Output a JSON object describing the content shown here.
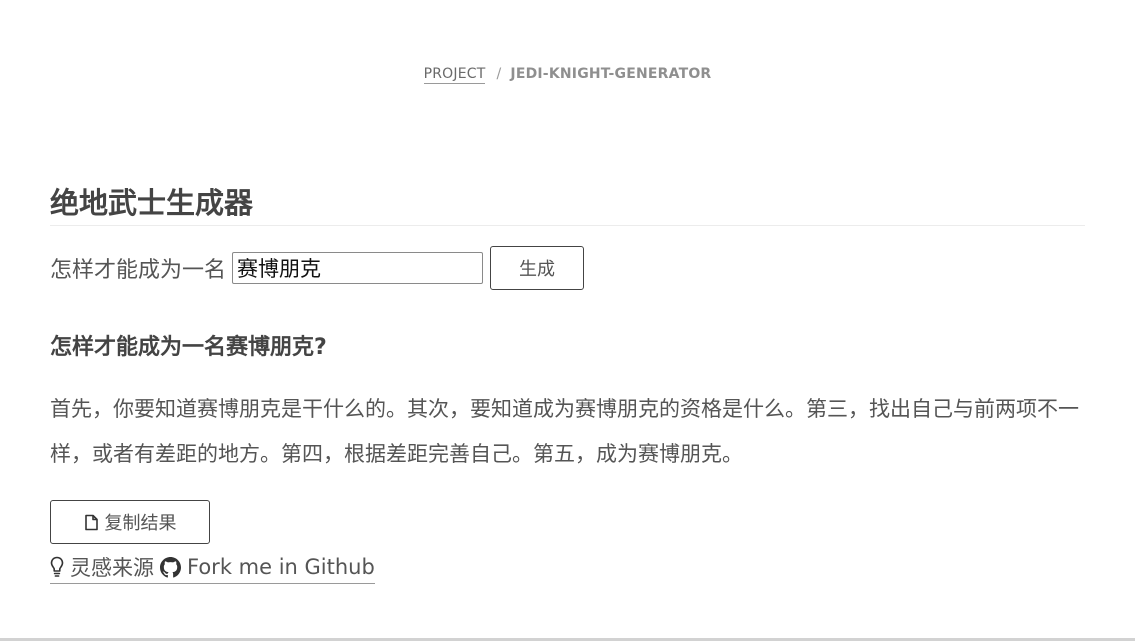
{
  "breadcrumb": {
    "parent": "PROJECT",
    "separator": "/",
    "current": "JEDI-KNIGHT-GENERATOR"
  },
  "page": {
    "title": "绝地武士生成器"
  },
  "form": {
    "label": "怎样才能成为一名",
    "input_value": "赛博朋克",
    "generate_label": "生成"
  },
  "result": {
    "heading": "怎样才能成为一名赛博朋克?",
    "body": "首先，你要知道赛博朋克是干什么的。其次，要知道成为赛博朋克的资格是什么。第三，找出自己与前两项不一样，或者有差距的地方。第四，根据差距完善自己。第五，成为赛博朋克。",
    "copy_label": "复制结果",
    "copy_icon": "file-icon"
  },
  "footer": {
    "inspiration_label": "灵感来源",
    "inspiration_icon": "lightbulb-icon",
    "github_label": "Fork me in Github",
    "github_icon": "github-icon"
  }
}
